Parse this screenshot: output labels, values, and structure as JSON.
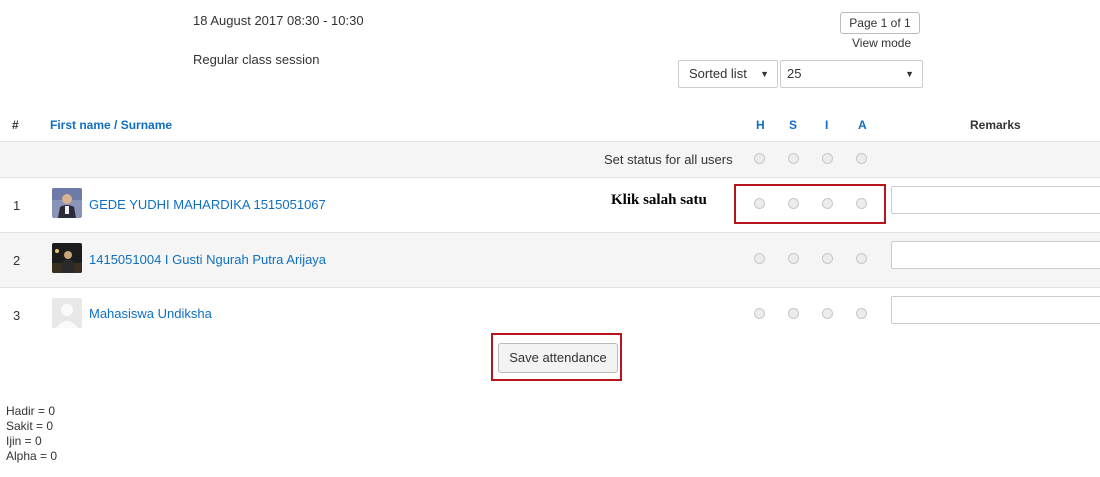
{
  "session": {
    "date": "18 August 2017 08:30 - 10:30",
    "description": "Regular class session"
  },
  "pager": {
    "label": "Page 1 of 1",
    "view_mode_label": "View mode"
  },
  "view": {
    "sort_selected": "Sorted list",
    "per_page_selected": "25"
  },
  "table": {
    "headers": {
      "num": "#",
      "name": "First name / Surname",
      "status": [
        "H",
        "S",
        "I",
        "A"
      ],
      "remarks": "Remarks"
    },
    "set_all_label": "Set status for all users",
    "rows": [
      {
        "num": "1",
        "name": "GEDE YUDHI MAHARDIKA 1515051067"
      },
      {
        "num": "2",
        "name": "1415051004 I Gusti Ngurah Putra Arijaya"
      },
      {
        "num": "3",
        "name": "Mahasiswa Undiksha"
      }
    ]
  },
  "annotation": {
    "text": "Klik salah satu",
    "color": "#b8141c"
  },
  "save_button": "Save attendance",
  "summary": [
    "Hadir = 0",
    "Sakit = 0",
    "Ijin = 0",
    "Alpha = 0"
  ],
  "colors": {
    "link": "#0f6fc5",
    "highlight": "#b8141c"
  }
}
